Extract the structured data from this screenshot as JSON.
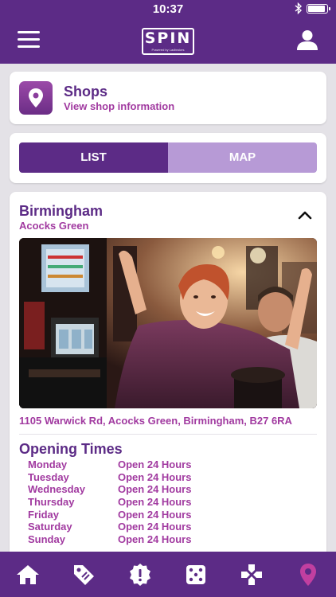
{
  "status_bar": {
    "time": "10:37",
    "bluetooth": "bluetooth-icon",
    "battery": "battery-icon"
  },
  "header": {
    "logo_text": "SPIN",
    "logo_subtext": "Powered by Ladbrokes",
    "menu_icon": "hamburger-menu-icon",
    "account_icon": "user-icon"
  },
  "shops_card": {
    "icon": "location-pin-icon",
    "title": "Shops",
    "subtitle": "View shop information"
  },
  "view_toggle": {
    "list_label": "LIST",
    "map_label": "MAP",
    "selected": "LIST"
  },
  "shop": {
    "city": "Birmingham",
    "area": "Acocks Green",
    "expand_icon": "chevron-up-icon",
    "address": "1105 Warwick Rd, Acocks Green, Birmingham, B27 6RA",
    "opening_title": "Opening Times",
    "hours": [
      {
        "day": "Monday",
        "time": "Open 24 Hours"
      },
      {
        "day": "Tuesday",
        "time": "Open 24 Hours"
      },
      {
        "day": "Wednesday",
        "time": "Open 24 Hours"
      },
      {
        "day": "Thursday",
        "time": "Open 24 Hours"
      },
      {
        "day": "Friday",
        "time": "Open 24 Hours"
      },
      {
        "day": "Saturday",
        "time": "Open 24 Hours"
      },
      {
        "day": "Sunday",
        "time": "Open 24 Hours"
      }
    ]
  },
  "tabbar": {
    "tabs": [
      {
        "icon": "home-icon",
        "active": false
      },
      {
        "icon": "price-tag-icon",
        "active": false
      },
      {
        "icon": "alert-badge-icon",
        "active": false
      },
      {
        "icon": "dice-icon",
        "active": false
      },
      {
        "icon": "gamepad-icon",
        "active": false
      },
      {
        "icon": "location-pin-icon",
        "active": true
      }
    ]
  },
  "colors": {
    "brand_purple": "#5c2b86",
    "accent_magenta": "#a13aa0",
    "inactive_tab": "#b79ad6",
    "active_tab_icon": "#c13fa0",
    "background": "#e4e2e7"
  }
}
